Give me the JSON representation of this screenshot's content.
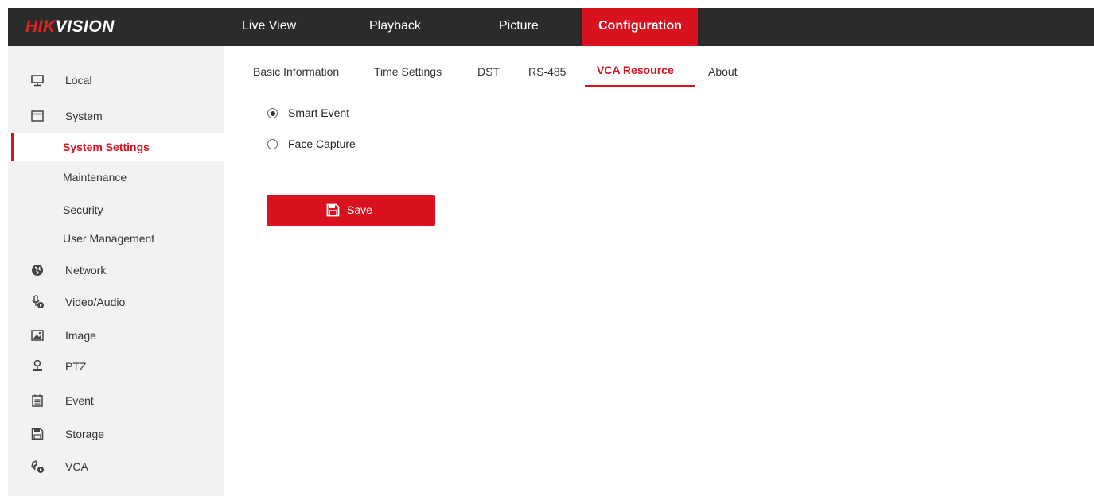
{
  "brand": {
    "logo_red": "HIK",
    "logo_white": "VISION"
  },
  "main_nav": [
    {
      "label": "Live View",
      "active": false
    },
    {
      "label": "Playback",
      "active": false
    },
    {
      "label": "Picture",
      "active": false
    },
    {
      "label": "Configuration",
      "active": true
    }
  ],
  "sidebar": {
    "items": [
      {
        "label": "Local",
        "icon": "monitor-icon"
      },
      {
        "label": "System",
        "icon": "window-icon"
      },
      {
        "label": "System Settings",
        "sub": true,
        "active": true
      },
      {
        "label": "Maintenance",
        "sub": true
      },
      {
        "label": "Security",
        "sub": true
      },
      {
        "label": "User Management",
        "sub": true
      },
      {
        "label": "Network",
        "icon": "globe-icon"
      },
      {
        "label": "Video/Audio",
        "icon": "microphone-icon"
      },
      {
        "label": "Image",
        "icon": "image-icon"
      },
      {
        "label": "PTZ",
        "icon": "ptz-icon"
      },
      {
        "label": "Event",
        "icon": "calendar-icon"
      },
      {
        "label": "Storage",
        "icon": "floppy-icon"
      },
      {
        "label": "VCA",
        "icon": "vca-icon"
      }
    ]
  },
  "sub_tabs": [
    {
      "label": "Basic Information",
      "active": false
    },
    {
      "label": "Time Settings",
      "active": false
    },
    {
      "label": "DST",
      "active": false
    },
    {
      "label": "RS-485",
      "active": false
    },
    {
      "label": "VCA Resource",
      "active": true
    },
    {
      "label": "About",
      "active": false
    }
  ],
  "vca_resource": {
    "options": [
      {
        "label": "Smart Event",
        "checked": true
      },
      {
        "label": "Face Capture",
        "checked": false
      }
    ],
    "save_label": "Save"
  },
  "colors": {
    "accent": "#d9121f",
    "topbar": "#2b2b2b",
    "sidebar": "#f2f2f2"
  }
}
